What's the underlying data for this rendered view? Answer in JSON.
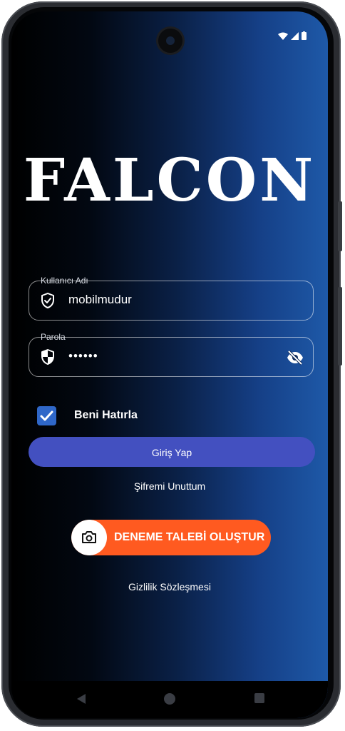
{
  "app": {
    "logo_text": "FALCON"
  },
  "login": {
    "username_label": "Kullanıcı Adı",
    "username_value": "mobilmudur",
    "password_label": "Parola",
    "password_value": "••••••",
    "remember_label": "Beni Hatırla",
    "remember_checked": true,
    "login_button": "Giriş Yap",
    "forgot_link": "Şifremi Unuttum",
    "demo_button": "DENEME TALEBİ OLUŞTUR",
    "privacy_link": "Gizlilik Sözleşmesi"
  },
  "status_bar": {
    "icons": [
      "wifi-icon",
      "signal-icon",
      "battery-icon"
    ]
  },
  "nav": {
    "icons": [
      "back-icon",
      "home-icon",
      "recents-icon"
    ]
  },
  "colors": {
    "login_button": "#4350c0",
    "demo_button": "#ff5a20",
    "checkbox": "#2f67c8",
    "gradient_end": "#1e59a8"
  }
}
